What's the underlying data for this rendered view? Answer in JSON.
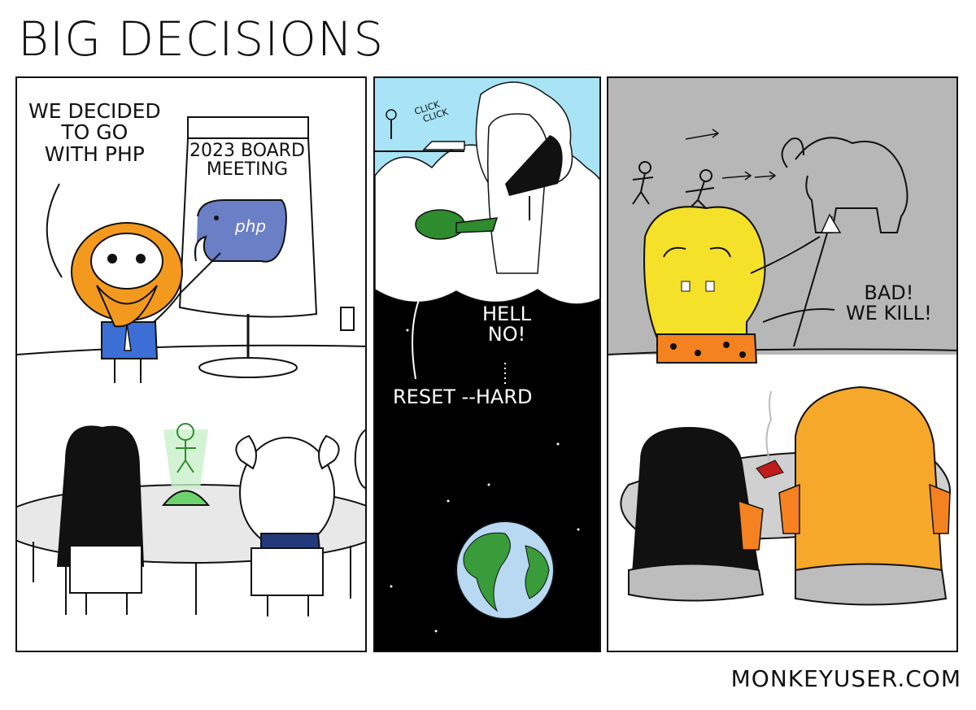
{
  "title": "BIG DECISIONS",
  "credit": "MONKEYUSER.COM",
  "panels": [
    {
      "caption": "WE DECIDED\nTO GO\nWITH PHP",
      "sign": "2023 BOARD\nMEETING",
      "logo_text": "php"
    },
    {
      "sfx": "CLICK\n  CLICK",
      "caption_top": "HELL\nNO!",
      "caption_bottom": "RESET --HARD"
    },
    {
      "caption": "BAD!\nWE KILL!"
    }
  ],
  "colors": {
    "panel_border": "#111111",
    "beard_orange": "#f39a1e",
    "shirt_blue": "#3b6fd6",
    "php_blue": "#6b7fc7",
    "sky_blue": "#a8e4f5",
    "space_black": "#000000",
    "earth_blue": "#b9d8f2",
    "earth_green": "#3a9b3a",
    "caveman_yellow": "#f5e02a",
    "cave_wall": "#b7b7b7",
    "leopard_orange": "#f58220"
  }
}
